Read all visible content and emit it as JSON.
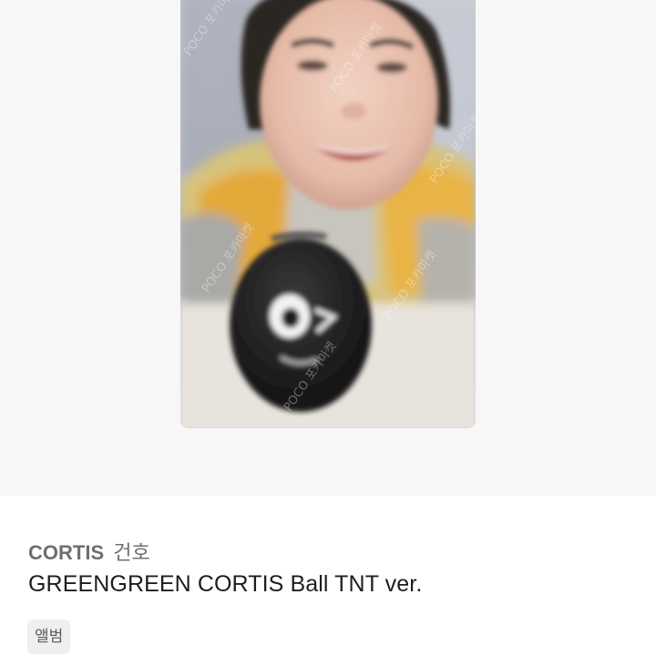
{
  "product": {
    "artist": "CORTIS",
    "member": "건호",
    "title": "GREENGREEN CORTIS Ball TNT ver.",
    "category_tag": "앨범"
  },
  "photo": {
    "watermark": "POCO 포카마켓"
  }
}
